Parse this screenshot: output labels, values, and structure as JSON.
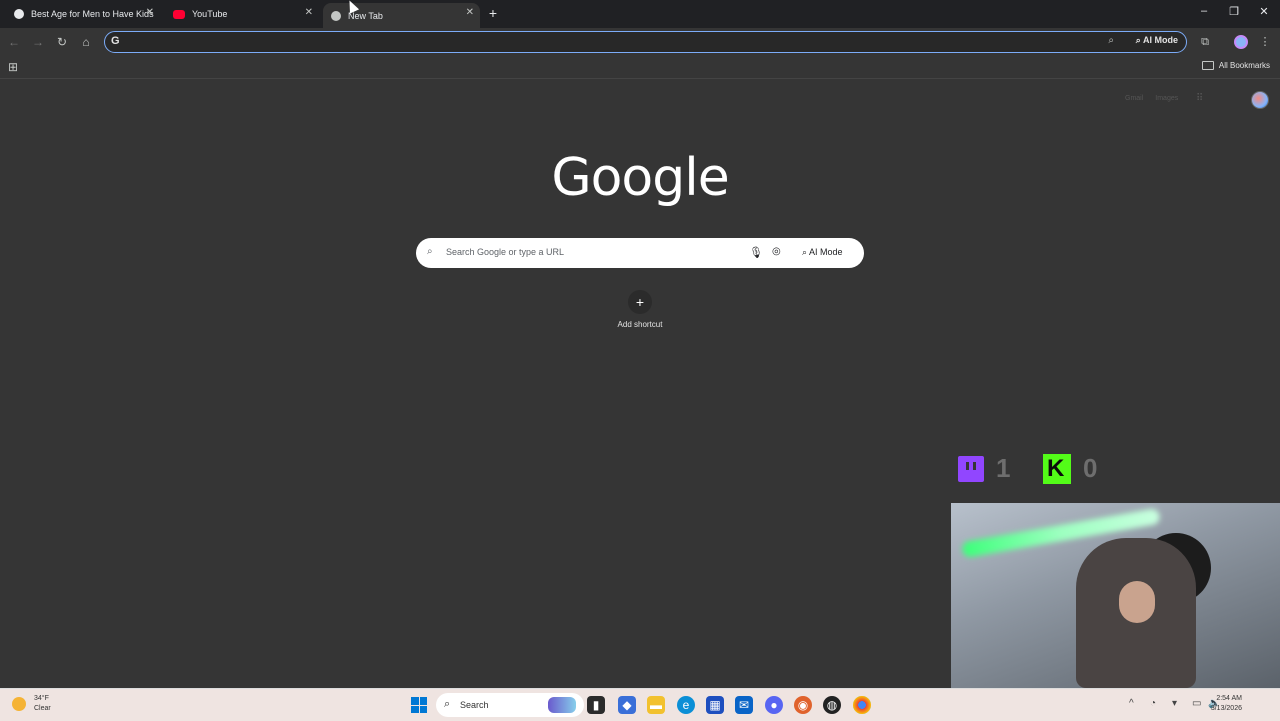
{
  "browser": {
    "tabs": [
      {
        "title": "Best Age for Men to Have Kids",
        "icon": "chatgpt-icon",
        "active": false
      },
      {
        "title": "YouTube",
        "icon": "youtube-icon",
        "active": false
      },
      {
        "title": "New Tab",
        "icon": "chrome-icon",
        "active": true
      }
    ],
    "omnibox": {
      "value": "",
      "ai_mode_label": "AI Mode"
    },
    "bookmarks": {
      "all_label": "All Bookmarks"
    }
  },
  "ntp": {
    "top_links": [
      "Gmail",
      "Images"
    ],
    "logo": "Google",
    "search_placeholder": "Search Google or type a URL",
    "ai_mode_label": "AI Mode",
    "shortcut_label": "Add shortcut"
  },
  "overlay": {
    "twitch_count": "1",
    "kick_count": "0"
  },
  "taskbar": {
    "weather_temp": "34°F",
    "weather_cond": "Clear",
    "search_label": "Search",
    "time": "2:54 AM",
    "date": "3/13/2026"
  },
  "colors": {
    "page_bg": "#353535",
    "tabstrip_bg": "#202124",
    "focus_ring": "#7cacf8",
    "twitch": "#9146ff",
    "kick": "#53fc18"
  }
}
